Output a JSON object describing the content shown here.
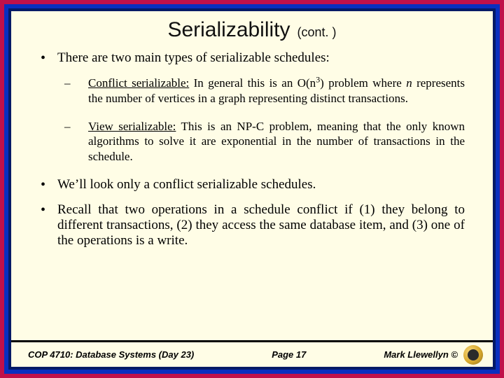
{
  "title": "Serializability",
  "title_suffix": "(cont. )",
  "bullets": {
    "intro": "There are two main types of serializable schedules:",
    "sub": {
      "conflict_label": "Conflict serializable:",
      "conflict_pre": "  In general this is an O(n",
      "conflict_sup": "3",
      "conflict_post": ") problem where ",
      "conflict_n": "n",
      "conflict_tail": " represents the number of vertices in a graph representing distinct transactions.",
      "view_label": "View serializable:",
      "view_text": "  This is an NP-C problem, meaning that the only known algorithms to solve it are exponential in the number of transactions in the schedule."
    },
    "look": "We’ll look only a conflict serializable schedules.",
    "recall": "Recall that two operations in a schedule conflict if (1) they belong to different transactions, (2) they access the same database item, and (3) one of the operations is a write."
  },
  "footer": {
    "course": "COP 4710: Database Systems  (Day 23)",
    "page": "Page 17",
    "author": "Mark Llewellyn ©"
  }
}
